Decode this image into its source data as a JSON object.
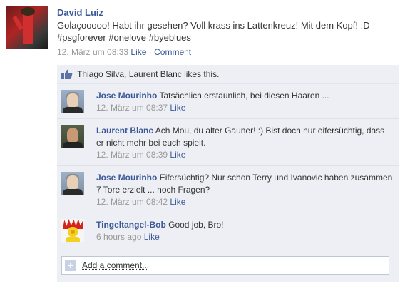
{
  "post": {
    "author": "David Luiz",
    "message": "Golaçooooo! Habt ihr gesehen? Voll krass ins Lattenkreuz! Mit dem Kopf! :D #psgforever #onelove #byeblues",
    "timestamp": "12. März um 08:33",
    "like_label": "Like",
    "separator": "·",
    "comment_label": "Comment"
  },
  "likes": {
    "text": "Thiago Silva, Laurent Blanc likes this.",
    "icon": "thumbs-up-icon"
  },
  "comments": [
    {
      "author": "Jose Mourinho",
      "text": "Tatsächlich erstaunlich, bei diesen Haaren ...",
      "timestamp": "12. März um 08:37",
      "like_label": "Like"
    },
    {
      "author": "Laurent Blanc",
      "text": "Ach Mou, du alter Gauner! :) Bist doch nur eifersüchtig, dass er nicht mehr bei euch spielt.",
      "timestamp": "12. März um 08:39",
      "like_label": "Like"
    },
    {
      "author": "Jose Mourinho",
      "text": "Eifersüchtig? Nur schon Terry und Ivanovic haben zusammen 7 Tore erzielt ... noch Fragen?",
      "timestamp": "12. März um 08:42",
      "like_label": "Like"
    },
    {
      "author": "Tingeltangel-Bob",
      "text": "Good job, Bro!",
      "timestamp": "6 hours ago",
      "like_label": "Like"
    }
  ],
  "add_comment": {
    "label": "Add a comment...",
    "icon": "plus-icon"
  },
  "colors": {
    "link": "#3b5998",
    "panel": "#edeff4",
    "meta": "#999999"
  }
}
